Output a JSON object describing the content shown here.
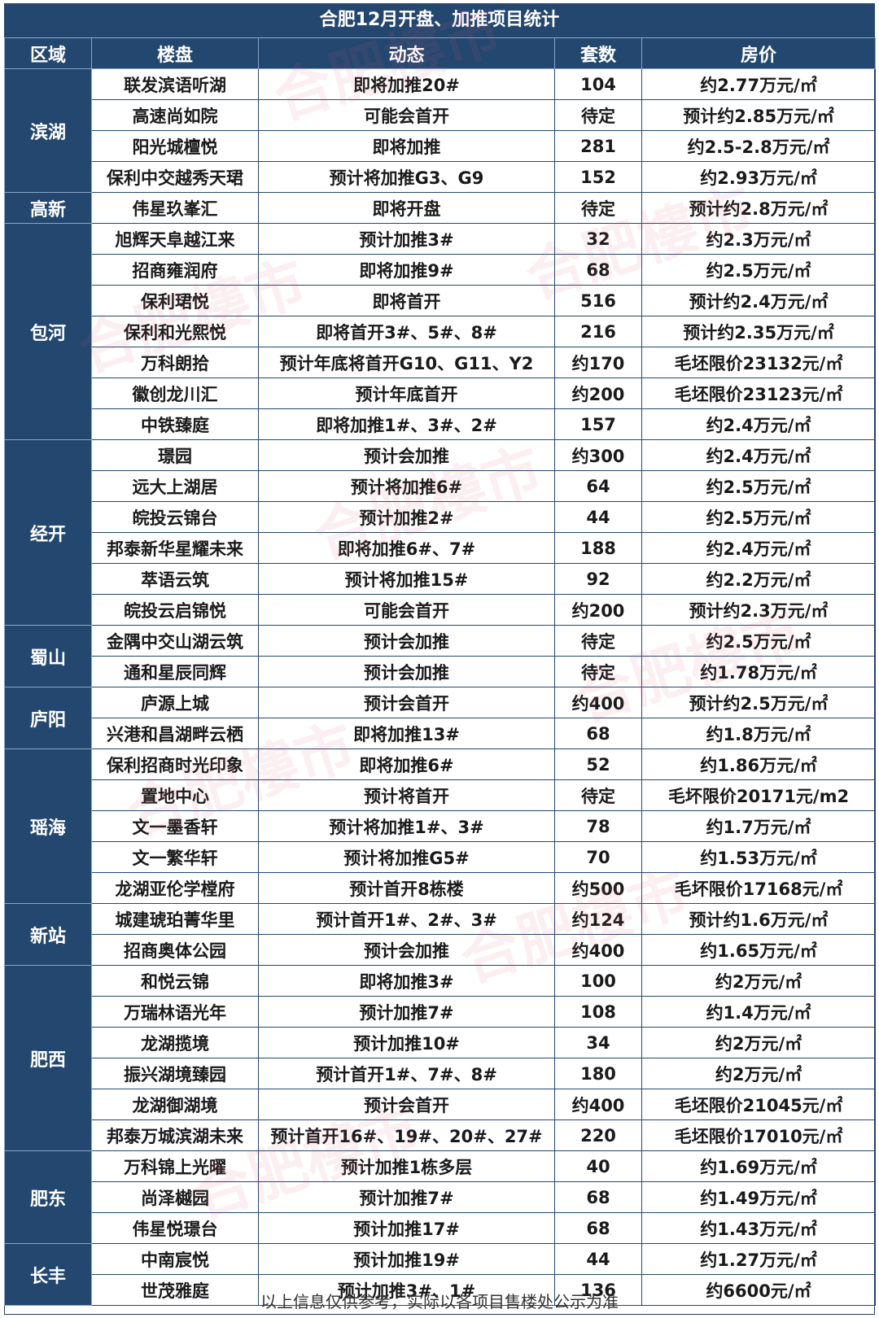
{
  "title": "合肥12月开盘、加推项目统计",
  "headers": [
    "区域",
    "楼盘",
    "动态",
    "套数",
    "房价"
  ],
  "groups": [
    {
      "region": "滨湖",
      "rows": [
        [
          "联发滨语听湖",
          "即将加推20#",
          "104",
          "约2.77万元/㎡"
        ],
        [
          "高速尚如院",
          "可能会首开",
          "待定",
          "预计约2.85万元/㎡"
        ],
        [
          "阳光城檀悦",
          "即将加推",
          "281",
          "约2.5-2.8万元/㎡"
        ],
        [
          "保利中交越秀天珺",
          "预计将加推G3、G9",
          "152",
          "约2.93万元/㎡"
        ]
      ]
    },
    {
      "region": "高新",
      "rows": [
        [
          "伟星玖峯汇",
          "即将开盘",
          "待定",
          "预计约2.8万元/㎡"
        ]
      ]
    },
    {
      "region": "包河",
      "rows": [
        [
          "旭辉天阜越江来",
          "预计加推3#",
          "32",
          "约2.3万元/㎡"
        ],
        [
          "招商雍润府",
          "即将加推9#",
          "68",
          "约2.5万元/㎡"
        ],
        [
          "保利珺悦",
          "即将首开",
          "516",
          "预计约2.4万元/㎡"
        ],
        [
          "保利和光熙悦",
          "即将首开3#、5#、8#",
          "216",
          "预计约2.35万元/㎡"
        ],
        [
          "万科朗拾",
          "预计年底将首开G10、G11、Y2",
          "约170",
          "毛坯限价23132元/㎡"
        ],
        [
          "徽创龙川汇",
          "预计年底首开",
          "约200",
          "毛坯限价23123元/㎡"
        ],
        [
          "中铁臻庭",
          "即将加推1#、3#、2#",
          "157",
          "约2.4万元/㎡"
        ]
      ]
    },
    {
      "region": "经开",
      "rows": [
        [
          "璟园",
          "预计会加推",
          "约300",
          "约2.4万元/㎡"
        ],
        [
          "远大上湖居",
          "预计将加推6#",
          "64",
          "约2.5万元/㎡"
        ],
        [
          "皖投云锦台",
          "预计加推2#",
          "44",
          "约2.5万元/㎡"
        ],
        [
          "邦泰新华星耀未来",
          "即将加推6#、7#",
          "188",
          "约2.4万元/㎡"
        ],
        [
          "萃语云筑",
          "预计将加推15#",
          "92",
          "约2.2万元/㎡"
        ],
        [
          "皖投云启锦悦",
          "可能会首开",
          "约200",
          "预计约2.3万元/㎡"
        ]
      ]
    },
    {
      "region": "蜀山",
      "rows": [
        [
          "金隅中交山湖云筑",
          "预计会加推",
          "待定",
          "约2.5万元/㎡"
        ],
        [
          "通和星辰同辉",
          "预计会加推",
          "待定",
          "约1.78万元/㎡"
        ]
      ]
    },
    {
      "region": "庐阳",
      "rows": [
        [
          "庐源上城",
          "预计会首开",
          "约400",
          "预计约2.5万元/㎡"
        ],
        [
          "兴港和昌湖畔云栖",
          "即将加推13#",
          "68",
          "约1.8万元/㎡"
        ]
      ]
    },
    {
      "region": "瑶海",
      "rows": [
        [
          "保利招商时光印象",
          "即将加推6#",
          "52",
          "约1.86万元/㎡"
        ],
        [
          "置地中心",
          "预计将首开",
          "待定",
          "毛坏限价20171元/m2"
        ],
        [
          "文一墨香轩",
          "预计将加推1#、3#",
          "78",
          "约1.7万元/㎡"
        ],
        [
          "文一繁华轩",
          "预计将加推G5#",
          "70",
          "约1.53万元/㎡"
        ],
        [
          "龙湖亚伦学樘府",
          "预计首开8栋楼",
          "约500",
          "毛坏限价17168元/㎡"
        ]
      ]
    },
    {
      "region": "新站",
      "rows": [
        [
          "城建琥珀菁华里",
          "预计首开1#、2#、3#",
          "约124",
          "预计约1.6万元/㎡"
        ],
        [
          "招商奥体公园",
          "预计会加推",
          "约400",
          "约1.65万元/㎡"
        ]
      ]
    },
    {
      "region": "肥西",
      "rows": [
        [
          "和悦云锦",
          "即将加推3#",
          "100",
          "约2万元/㎡"
        ],
        [
          "万瑞林语光年",
          "预计加推7#",
          "108",
          "约1.4万元/㎡"
        ],
        [
          "龙湖揽境",
          "预计加推10#",
          "34",
          "约2万元/㎡"
        ],
        [
          "振兴湖境臻园",
          "预计首开1#、7#、8#",
          "180",
          "约2万元/㎡"
        ],
        [
          "龙湖御湖境",
          "预计会首开",
          "约400",
          "毛坯限价21045元/㎡"
        ],
        [
          "邦泰万城滨湖未来",
          "预计首开16#、19#、20#、27#",
          "220",
          "毛坯限价17010元/㎡"
        ]
      ]
    },
    {
      "region": "肥东",
      "rows": [
        [
          "万科锦上光曜",
          "预计加推1栋多层",
          "40",
          "约1.69万元/㎡"
        ],
        [
          "尚泽樾园",
          "预计加推7#",
          "68",
          "约1.49万元/㎡"
        ],
        [
          "伟星悦璟台",
          "预计加推17#",
          "68",
          "约1.43万元/㎡"
        ]
      ]
    },
    {
      "region": "长丰",
      "rows": [
        [
          "中南宸悦",
          "预计加推19#",
          "44",
          "约1.27万元/㎡"
        ],
        [
          "世茂雅庭",
          "预计加推3#、1#",
          "136",
          "约6600元/㎡"
        ]
      ]
    }
  ],
  "footer": "以上信息仅供参考，实际以各项目售楼处公示为准",
  "watermark": "合肥樓市",
  "colors": {
    "header_bg": "#24476f",
    "header_text": "#ffffff",
    "border": "#24476f",
    "text": "#1a1a1a"
  }
}
